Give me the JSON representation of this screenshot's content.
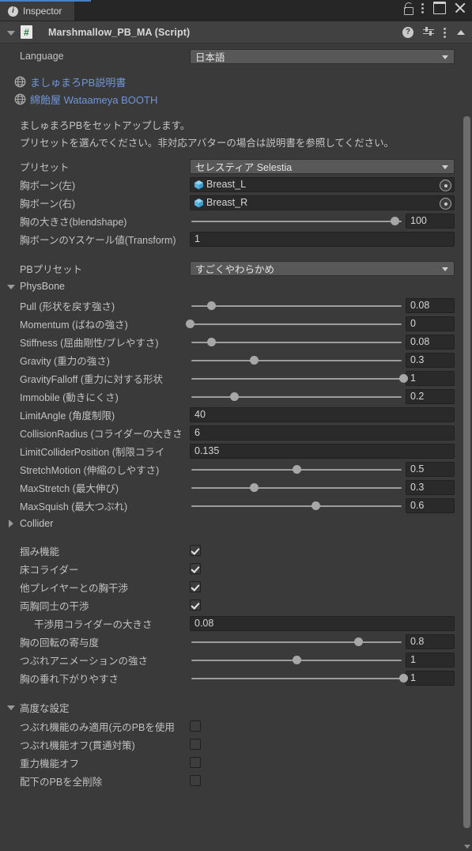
{
  "window": {
    "tab_label": "Inspector",
    "tab_icon": "info-icon",
    "lock_icon": "lock-icon",
    "menu_icon": "kebab-menu-icon",
    "maximize_icon": "maximize-icon",
    "close_icon": "close-icon",
    "accent_color": "#4a7fbd"
  },
  "component": {
    "title": "Marshmallow_PB_MA (Script)",
    "script_icon_glyph": "#",
    "help_icon": "help-icon",
    "preset_icon": "preset-icon",
    "menu_icon": "kebab-menu-icon",
    "collapse_icon": "collapse-arrow-icon"
  },
  "language": {
    "label": "Language",
    "value": "日本語"
  },
  "links": [
    {
      "text": "ましゅまろPB説明書",
      "icon": "globe-icon"
    },
    {
      "text": "綿飴屋 Wataameya BOOTH",
      "icon": "globe-icon"
    }
  ],
  "description": [
    "ましゅまろPBをセットアップします。",
    "プリセットを選んでください。非対応アバターの場合は説明書を参照してください。"
  ],
  "setup": {
    "preset": {
      "label": "プリセット",
      "value": "セレスティア Selestia"
    },
    "bone_left": {
      "label": "胸ボーン(左)",
      "value": "Breast_L",
      "icon": "gameobject-cube-icon"
    },
    "bone_right": {
      "label": "胸ボーン(右)",
      "value": "Breast_R",
      "icon": "gameobject-cube-icon"
    },
    "breast_size": {
      "label": "胸の大きさ(blendshape)",
      "value": "100",
      "slider_pct": 96
    },
    "bone_yscale": {
      "label": "胸ボーンのYスケール値(Transform)",
      "value": "1"
    }
  },
  "pb_preset": {
    "label": "PBプリセット",
    "value": "すごくやわらかめ"
  },
  "physbone": {
    "section_label": "PhysBone",
    "expanded": true,
    "rows": [
      {
        "label": "Pull (形状を戻す強さ)",
        "value": "0.08",
        "type": "slider",
        "slider_pct": 10
      },
      {
        "label": "Momentum (ばねの強さ)",
        "value": "0",
        "type": "slider",
        "slider_pct": 0
      },
      {
        "label": "Stiffness (屈曲剛性/ブレやすさ)",
        "value": "0.08",
        "type": "slider",
        "slider_pct": 10
      },
      {
        "label": "Gravity (重力の強さ)",
        "value": "0.3",
        "type": "slider",
        "slider_pct": 30
      },
      {
        "label": "GravityFalloff (重力に対する形状",
        "value": "1",
        "type": "slider",
        "slider_pct": 100
      },
      {
        "label": "Immobile (動きにくさ)",
        "value": "0.2",
        "type": "slider",
        "slider_pct": 21
      },
      {
        "label": "LimitAngle (角度制限)",
        "value": "40",
        "type": "field"
      },
      {
        "label": "CollisionRadius (コライダーの大きさ",
        "value": "6",
        "type": "field"
      },
      {
        "label": "LimitColliderPosition (制限コライ",
        "value": "0.135",
        "type": "field"
      },
      {
        "label": "StretchMotion (伸縮のしやすさ)",
        "value": "0.5",
        "type": "slider",
        "slider_pct": 50
      },
      {
        "label": "MaxStretch (最大伸び)",
        "value": "0.3",
        "type": "slider",
        "slider_pct": 30
      },
      {
        "label": "MaxSquish (最大つぶれ)",
        "value": "0.6",
        "type": "slider",
        "slider_pct": 59
      }
    ]
  },
  "collider": {
    "section_label": "Collider",
    "expanded": false
  },
  "toggles": [
    {
      "label": "掴み機能",
      "checked": true
    },
    {
      "label": "床コライダー",
      "checked": true
    },
    {
      "label": "他プレイヤーとの胸干渉",
      "checked": true
    },
    {
      "label": "両胸同士の干渉",
      "checked": true
    }
  ],
  "collider_size": {
    "label": "干渉用コライダーの大きさ",
    "value": "0.08"
  },
  "extra_sliders": [
    {
      "label": "胸の回転の寄与度",
      "value": "0.8",
      "slider_pct": 79
    },
    {
      "label": "つぶれアニメーションの強さ",
      "value": "1",
      "slider_pct": 50
    },
    {
      "label": "胸の垂れ下がりやすさ",
      "value": "1",
      "slider_pct": 100
    }
  ],
  "advanced": {
    "section_label": "高度な設定",
    "expanded": true,
    "toggles": [
      {
        "label": "つぶれ機能のみ適用(元のPBを使用",
        "checked": false
      },
      {
        "label": "つぶれ機能オフ(貫通対策)",
        "checked": false
      },
      {
        "label": "重力機能オフ",
        "checked": false
      },
      {
        "label": "配下のPBを全削除",
        "checked": false
      }
    ]
  },
  "scrollbar": {
    "name": "vertical-scrollbar"
  }
}
